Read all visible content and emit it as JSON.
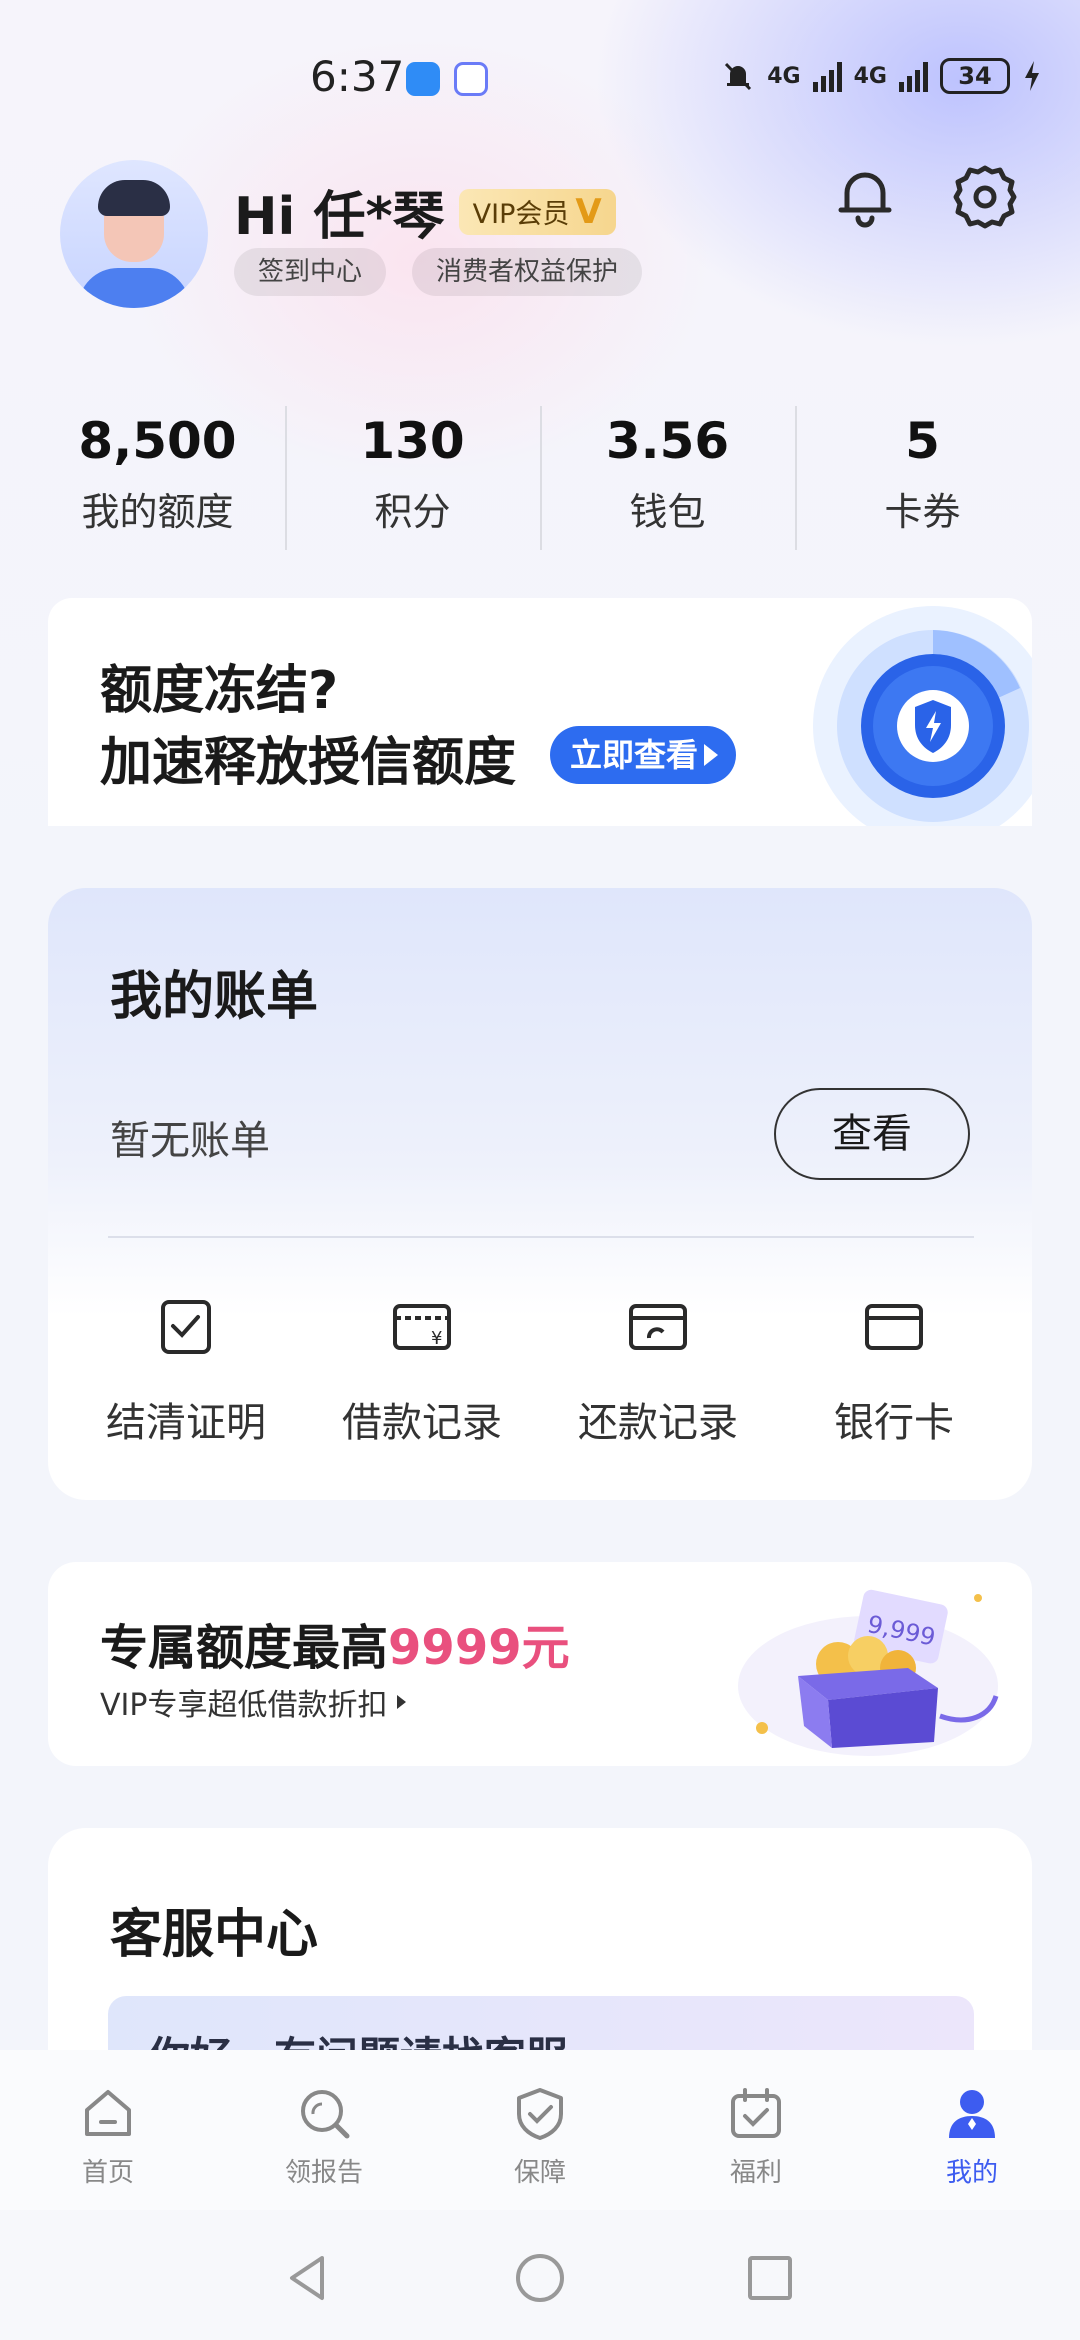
{
  "status_bar": {
    "time": "6:37",
    "network_1": "4G",
    "network_2": "4G",
    "battery": "34"
  },
  "profile": {
    "greeting": "Hi 任*琴",
    "vip_label": "VIP会员",
    "vip_mark": "V",
    "pill_checkin": "签到中心",
    "pill_consumer": "消费者权益保护"
  },
  "stats": [
    {
      "value": "8,500",
      "label": "我的额度"
    },
    {
      "value": "130",
      "label": "积分"
    },
    {
      "value": "3.56",
      "label": "钱包"
    },
    {
      "value": "5",
      "label": "卡券"
    }
  ],
  "promo": {
    "line1": "额度冻结?",
    "line2": "加速释放授信额度",
    "button": "立即查看"
  },
  "bill": {
    "title": "我的账单",
    "empty_text": "暂无账单",
    "view_button": "查看",
    "quick_actions": [
      {
        "label": "结清证明",
        "icon": "settlement-certificate-icon"
      },
      {
        "label": "借款记录",
        "icon": "loan-record-icon"
      },
      {
        "label": "还款记录",
        "icon": "repayment-record-icon"
      },
      {
        "label": "银行卡",
        "icon": "bank-card-icon"
      }
    ]
  },
  "vip_offer": {
    "title_prefix": "专属额度最高",
    "title_highlight": "9999元",
    "subtitle": "VIP专享超低借款折扣",
    "art_amount": "9,999"
  },
  "service": {
    "title": "客服中心",
    "banner_text": "你好，有问题请找客服"
  },
  "tabbar": [
    {
      "label": "首页",
      "icon": "home-icon",
      "active": false
    },
    {
      "label": "领报告",
      "icon": "report-icon",
      "active": false
    },
    {
      "label": "保障",
      "icon": "shield-icon",
      "active": false
    },
    {
      "label": "福利",
      "icon": "calendar-check-icon",
      "active": false
    },
    {
      "label": "我的",
      "icon": "profile-icon",
      "active": true
    }
  ],
  "colors": {
    "accent_blue": "#2d6cf0",
    "tab_active": "#3d5cf0",
    "highlight_pink": "#e9507e",
    "vip_gold": "#f6d68e"
  }
}
